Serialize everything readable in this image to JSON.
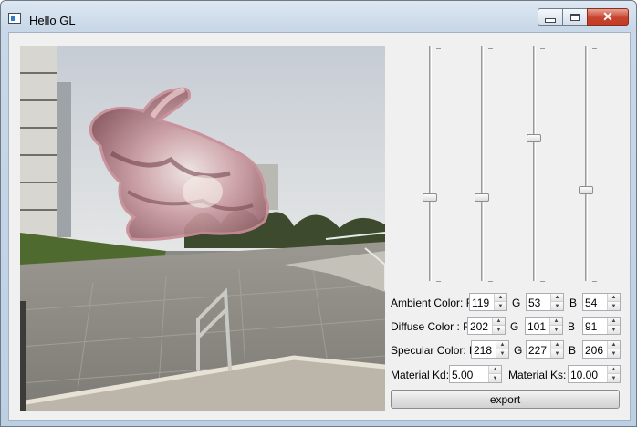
{
  "window": {
    "title": "Hello GL",
    "close_glyph": "✕"
  },
  "icons": {
    "app": "window-app-icon",
    "minimize": "minimize-icon",
    "maximize": "maximize-icon",
    "close": "close-icon"
  },
  "sliders": [
    {
      "name": "slider-1",
      "level": 0.35
    },
    {
      "name": "slider-2",
      "level": 0.35
    },
    {
      "name": "slider-3",
      "level": 0.61
    },
    {
      "name": "slider-4",
      "level": 0.38
    }
  ],
  "ambient": {
    "label": "Ambient Color: R",
    "g_label": "G",
    "b_label": "B",
    "r": "119",
    "g": "53",
    "b": "54"
  },
  "diffuse": {
    "label": "Diffuse Color : R",
    "g_label": "G",
    "b_label": "B",
    "r": "202",
    "g": "101",
    "b": "91"
  },
  "specular": {
    "label": "Specular Color: R",
    "g_label": "G",
    "b_label": "B",
    "r": "218",
    "g": "227",
    "b": "206"
  },
  "material": {
    "kd_label": "Material Kd:",
    "kd": "5.00",
    "ks_label": "Material Ks:",
    "ks": "10.00"
  },
  "export_label": "export",
  "colors": {
    "bunny": "#d9a7ad",
    "sky": "#d8dde2",
    "ground": "#8e8e88"
  }
}
